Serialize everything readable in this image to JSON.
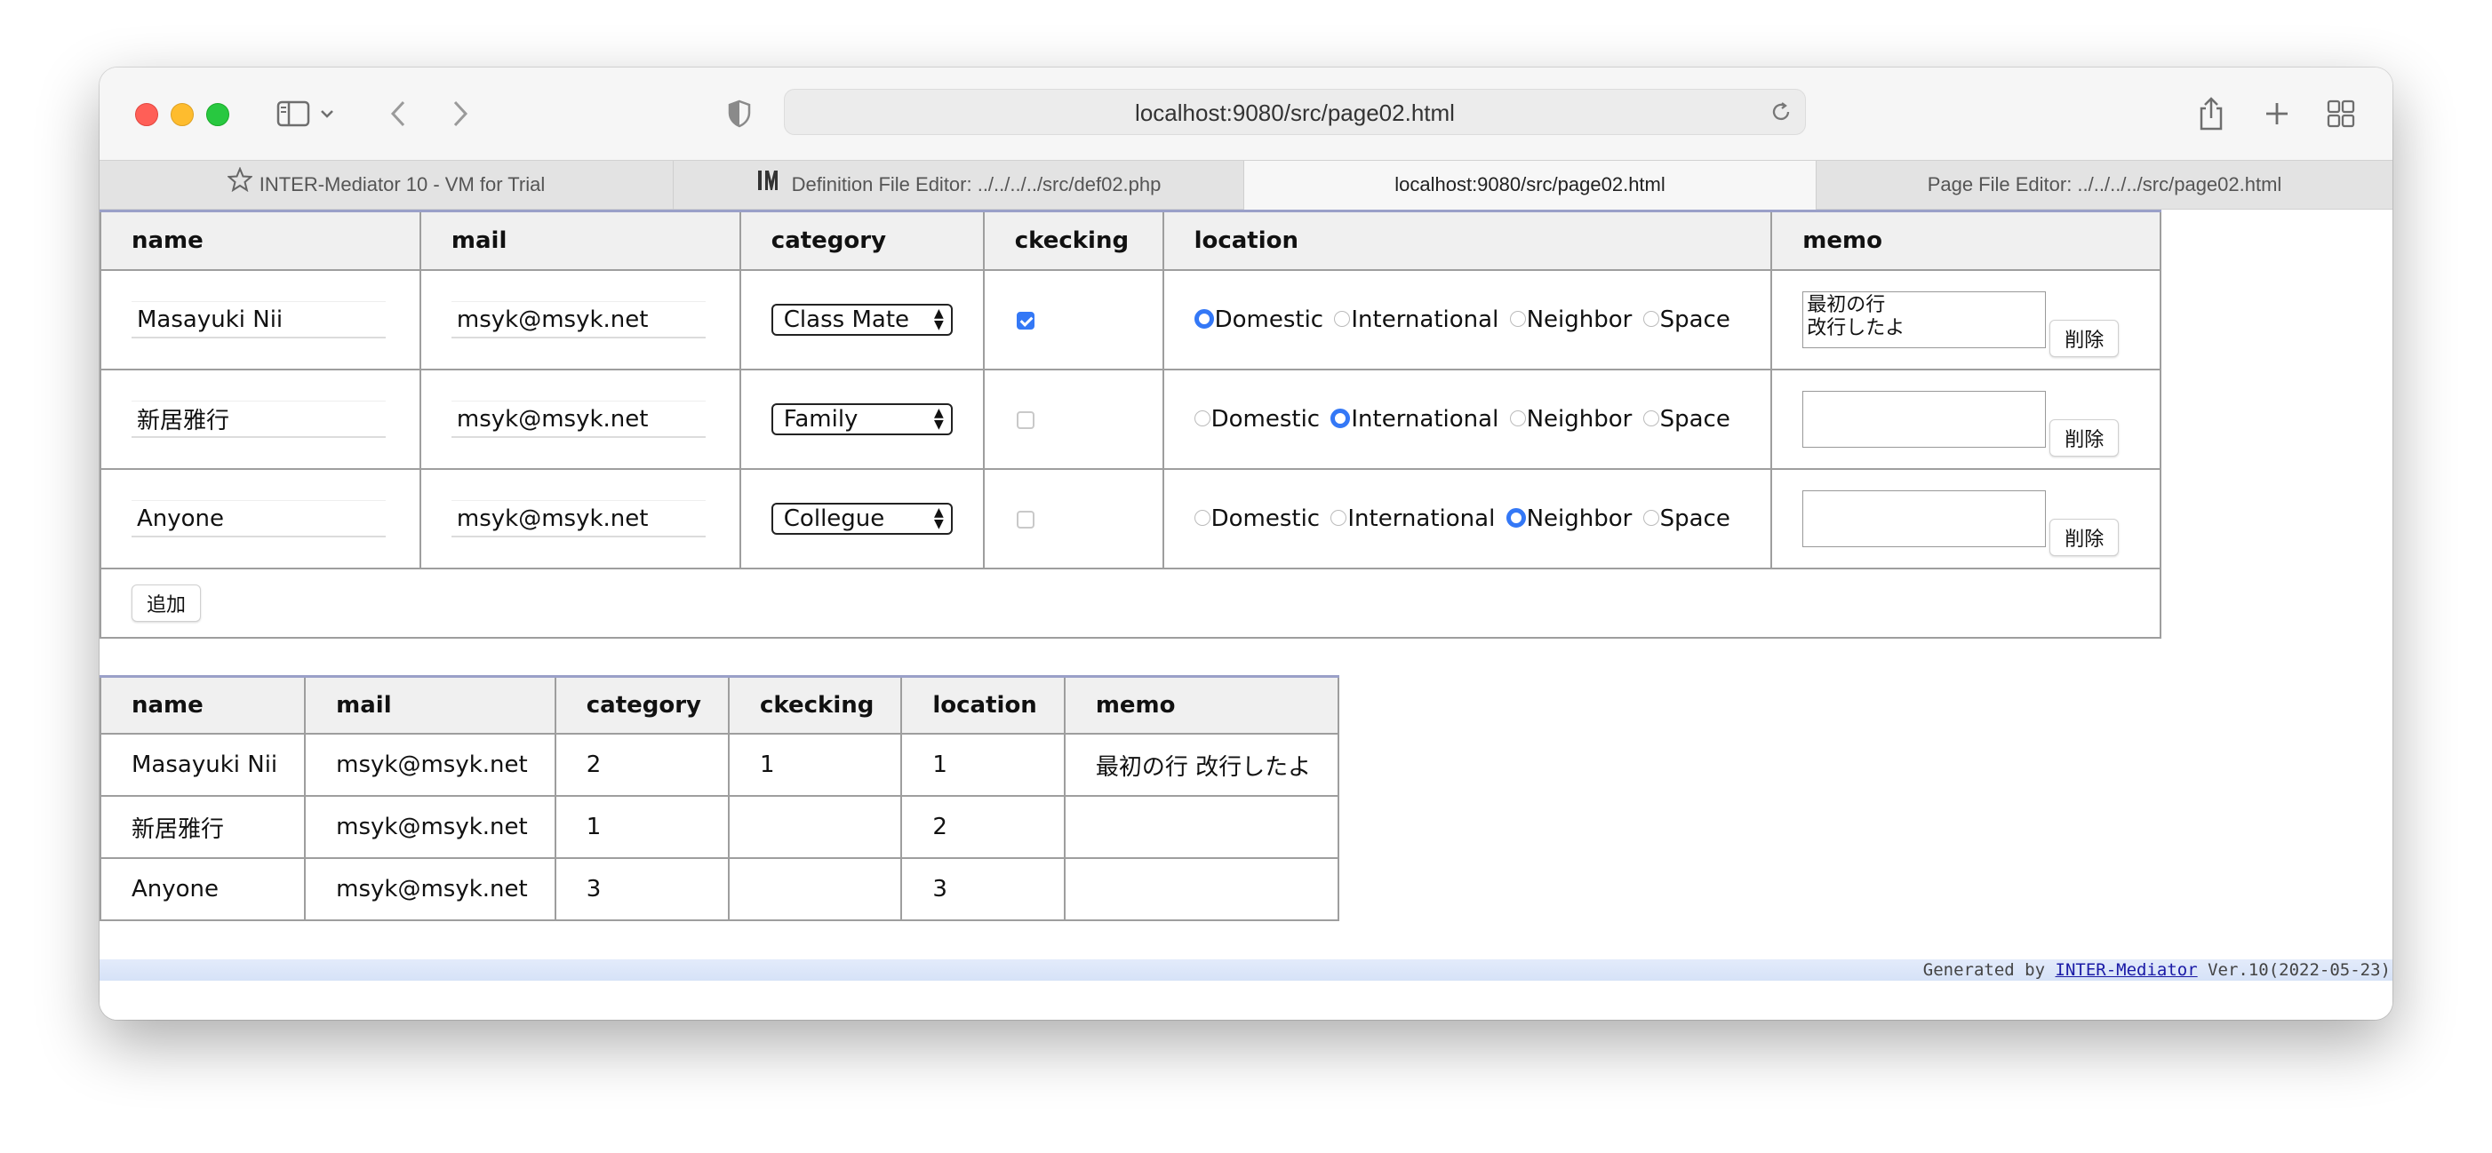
{
  "browser": {
    "url": "localhost:9080/src/page02.html",
    "tabs": [
      {
        "label": "INTER-Mediator 10 - VM for Trial",
        "icon": "star-icon",
        "active": false
      },
      {
        "label": "Definition File Editor: ../../../../src/def02.php",
        "icon": "im-logo-icon",
        "active": false
      },
      {
        "label": "localhost:9080/src/page02.html",
        "icon": "",
        "active": true
      },
      {
        "label": "Page File Editor: ../../../../src/page02.html",
        "icon": "",
        "active": false
      }
    ]
  },
  "editor": {
    "headers": [
      "name",
      "mail",
      "category",
      "ckecking",
      "location",
      "memo"
    ],
    "location_options": [
      "Domestic",
      "International",
      "Neighbor",
      "Space"
    ],
    "delete_label": "削除",
    "add_label": "追加",
    "rows": [
      {
        "name": "Masayuki Nii",
        "mail": "msyk@msyk.net",
        "category": "Class Mate",
        "checked": true,
        "location": "Domestic",
        "memo": "最初の行\n改行したよ"
      },
      {
        "name": "新居雅行",
        "mail": "msyk@msyk.net",
        "category": "Family",
        "checked": false,
        "location": "International",
        "memo": ""
      },
      {
        "name": "Anyone",
        "mail": "msyk@msyk.net",
        "category": "Collegue",
        "checked": false,
        "location": "Neighbor",
        "memo": ""
      }
    ]
  },
  "list": {
    "headers": [
      "name",
      "mail",
      "category",
      "ckecking",
      "location",
      "memo"
    ],
    "rows": [
      [
        "Masayuki Nii",
        "msyk@msyk.net",
        "2",
        "1",
        "1",
        "最初の行 改行したよ"
      ],
      [
        "新居雅行",
        "msyk@msyk.net",
        "1",
        "",
        "2",
        ""
      ],
      [
        "Anyone",
        "msyk@msyk.net",
        "3",
        "",
        "3",
        ""
      ]
    ]
  },
  "footer": {
    "prefix": "Generated by ",
    "link": "INTER-Mediator",
    "suffix": " Ver.10(2022-05-23)"
  },
  "colors": {
    "accent": "#3478f6",
    "table_border_top": "#9aa0c8",
    "footer_bg": "#dde6f8"
  }
}
